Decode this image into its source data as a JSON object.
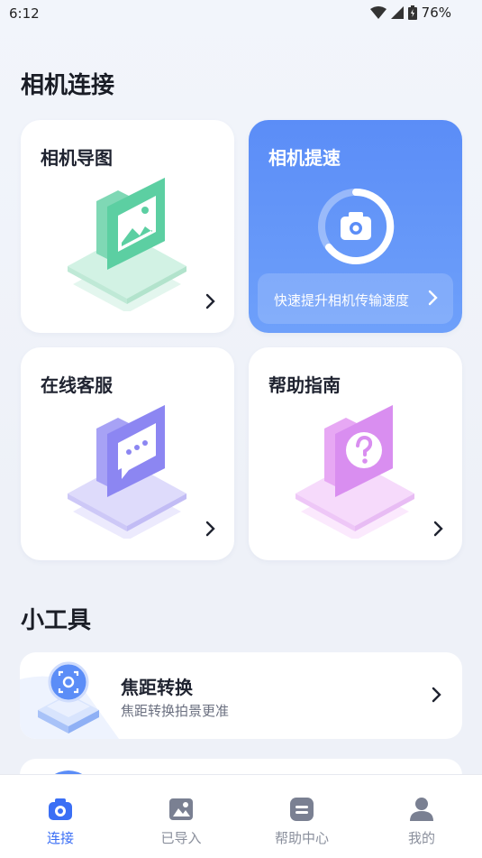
{
  "status_bar": {
    "time": "6:12",
    "battery": "76%"
  },
  "sections": {
    "camera_connect": "相机连接",
    "tools": "小工具"
  },
  "cards": {
    "guide": {
      "title": "相机导图"
    },
    "speed": {
      "title": "相机提速",
      "subtitle": "快速提升相机传输速度"
    },
    "service": {
      "title": "在线客服"
    },
    "help": {
      "title": "帮助指南"
    }
  },
  "tool": {
    "title": "焦距转换",
    "subtitle": "焦距转换拍景更准"
  },
  "nav": {
    "items": [
      {
        "label": "连接",
        "icon": "camera-icon",
        "active": true
      },
      {
        "label": "已导入",
        "icon": "image-icon",
        "active": false
      },
      {
        "label": "帮助中心",
        "icon": "help-center-icon",
        "active": false
      },
      {
        "label": "我的",
        "icon": "profile-icon",
        "active": false
      }
    ]
  },
  "colors": {
    "accent": "#3b6ff5",
    "speed_card_top": "#5b8df7",
    "guide_green": "#5ccfa2",
    "service_purple": "#8c86f2",
    "help_pink": "#d98ef0"
  }
}
